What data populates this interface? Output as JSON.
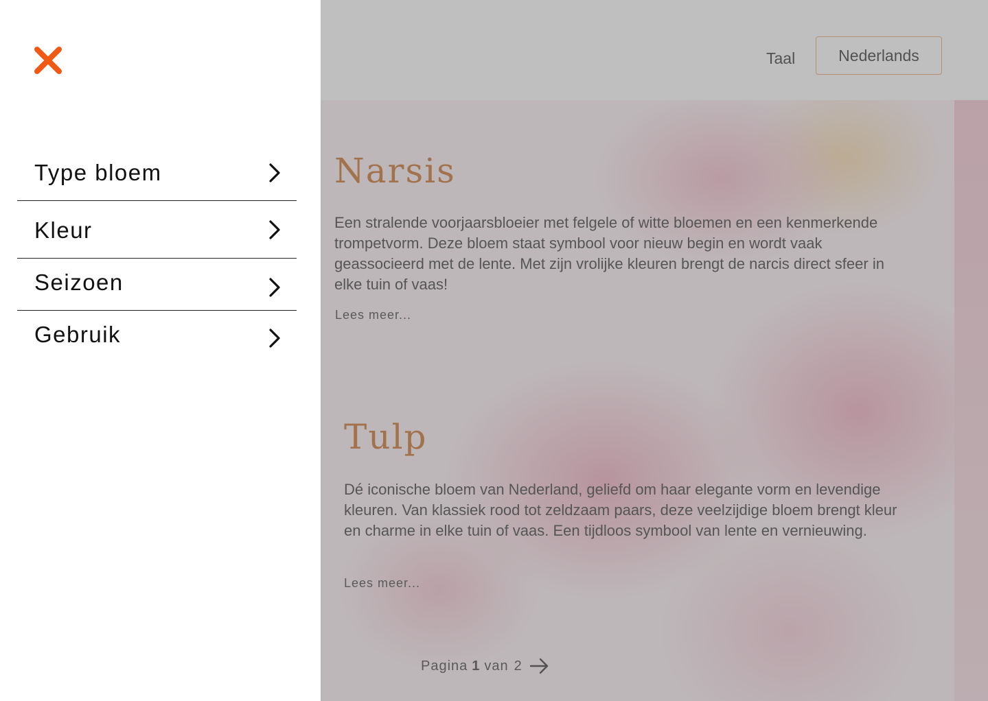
{
  "header": {
    "language_label": "Taal",
    "language_value": "Nederlands"
  },
  "articles": [
    {
      "title": "Narsis",
      "text": "Een stralende voorjaarsbloeier met felgele of witte bloemen en een kenmerkende trompetvorm. Deze bloem staat symbool voor nieuw begin en wordt vaak geassocieerd met de lente. Met zijn vrolijke kleuren brengt de narcis direct sfeer in elke tuin of vaas!",
      "read_more": "Lees meer..."
    },
    {
      "title": "Tulp",
      "text": "Dé iconische bloem van Nederland, geliefd om haar elegante vorm en levendige kleuren. Van klassiek rood tot zeldzaam paars, deze veelzijdige bloem brengt kleur en charme in elke tuin of vaas. Een tijdloos symbool van lente en vernieuwing.",
      "read_more": "Lees meer..."
    }
  ],
  "pagination": {
    "prefix": "Pagina",
    "current": "1",
    "middle": "van",
    "total": "2",
    "next_icon": "arrow-right-icon"
  },
  "sidemenu": {
    "close_icon": "close-icon",
    "items": [
      {
        "label": "Type bloem",
        "icon": "chevron-right-icon"
      },
      {
        "label": "Kleur",
        "icon": "chevron-right-icon"
      },
      {
        "label": "Seizoen",
        "icon": "chevron-right-icon"
      },
      {
        "label": "Gebruik",
        "icon": "chevron-right-icon"
      }
    ]
  },
  "colors": {
    "accent": "#f05a14",
    "title": "#c5651b",
    "select_border": "#e7a06a"
  }
}
